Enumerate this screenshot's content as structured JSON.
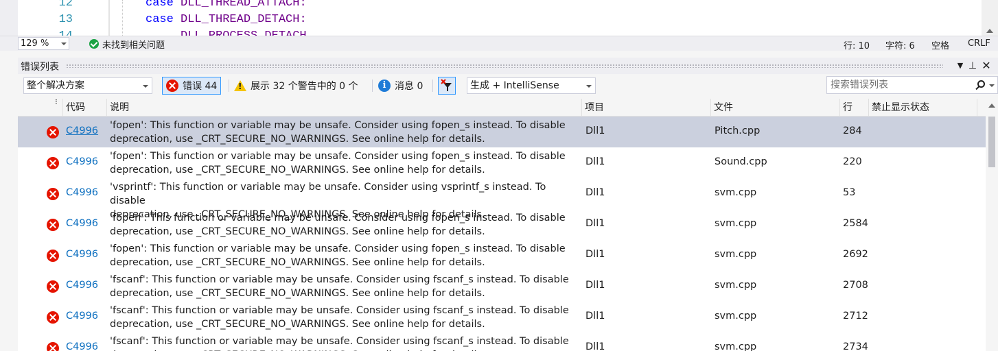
{
  "editor": {
    "lines": [
      {
        "number": "12",
        "keyword": "case",
        "macro": "DLL_THREAD_ATTACH:"
      },
      {
        "number": "13",
        "keyword": "case",
        "macro": "DLL_THREAD_DETACH:"
      },
      {
        "number": "14",
        "keyword": "",
        "macro": "DLL_PROCESS_DETACH"
      }
    ]
  },
  "status": {
    "zoom": "129 %",
    "issues": "未找到相关问题",
    "line": "行: 10",
    "char": "字符: 6",
    "whitespace": "空格",
    "eol": "CRLF"
  },
  "error_list": {
    "title": "错误列表",
    "scope": "整个解决方案",
    "errors_label": "错误 44",
    "warnings_label": "展示 32 个警告中的 0 个",
    "messages_label": "消息 0",
    "build_filter": "生成 + IntelliSense",
    "search_placeholder": "搜索错误列表",
    "columns": {
      "code": "代码",
      "description": "说明",
      "project": "项目",
      "file": "文件",
      "line": "行",
      "suppression": "禁止显示状态"
    },
    "rows": [
      {
        "code": "C4996",
        "desc": "'fopen': This function or variable may be unsafe. Consider using fopen_s instead. To disable\ndeprecation, use _CRT_SECURE_NO_WARNINGS. See online help for details.",
        "project": "Dll1",
        "file": "Pitch.cpp",
        "line": "284"
      },
      {
        "code": "C4996",
        "desc": "'fopen': This function or variable may be unsafe. Consider using fopen_s instead. To disable\ndeprecation, use _CRT_SECURE_NO_WARNINGS. See online help for details.",
        "project": "Dll1",
        "file": "Sound.cpp",
        "line": "220"
      },
      {
        "code": "C4996",
        "desc": "'vsprintf': This function or variable may be unsafe. Consider using vsprintf_s instead. To disable\ndeprecation, use _CRT_SECURE_NO_WARNINGS. See online help for details.",
        "project": "Dll1",
        "file": "svm.cpp",
        "line": "53"
      },
      {
        "code": "C4996",
        "desc": "'fopen': This function or variable may be unsafe. Consider using fopen_s instead. To disable\ndeprecation, use _CRT_SECURE_NO_WARNINGS. See online help for details.",
        "project": "Dll1",
        "file": "svm.cpp",
        "line": "2584"
      },
      {
        "code": "C4996",
        "desc": "'fopen': This function or variable may be unsafe. Consider using fopen_s instead. To disable\ndeprecation, use _CRT_SECURE_NO_WARNINGS. See online help for details.",
        "project": "Dll1",
        "file": "svm.cpp",
        "line": "2692"
      },
      {
        "code": "C4996",
        "desc": "'fscanf': This function or variable may be unsafe. Consider using fscanf_s instead. To disable\ndeprecation, use _CRT_SECURE_NO_WARNINGS. See online help for details.",
        "project": "Dll1",
        "file": "svm.cpp",
        "line": "2708"
      },
      {
        "code": "C4996",
        "desc": "'fscanf': This function or variable may be unsafe. Consider using fscanf_s instead. To disable\ndeprecation, use _CRT_SECURE_NO_WARNINGS. See online help for details.",
        "project": "Dll1",
        "file": "svm.cpp",
        "line": "2712"
      },
      {
        "code": "C4996",
        "desc": "'fscanf': This function or variable may be unsafe. Consider using fscanf_s instead. To disable\ndeprecation, use _CRT_SECURE_NO_WARNINGS. See online help for details.",
        "project": "Dll1",
        "file": "svm.cpp",
        "line": "2734"
      }
    ]
  }
}
